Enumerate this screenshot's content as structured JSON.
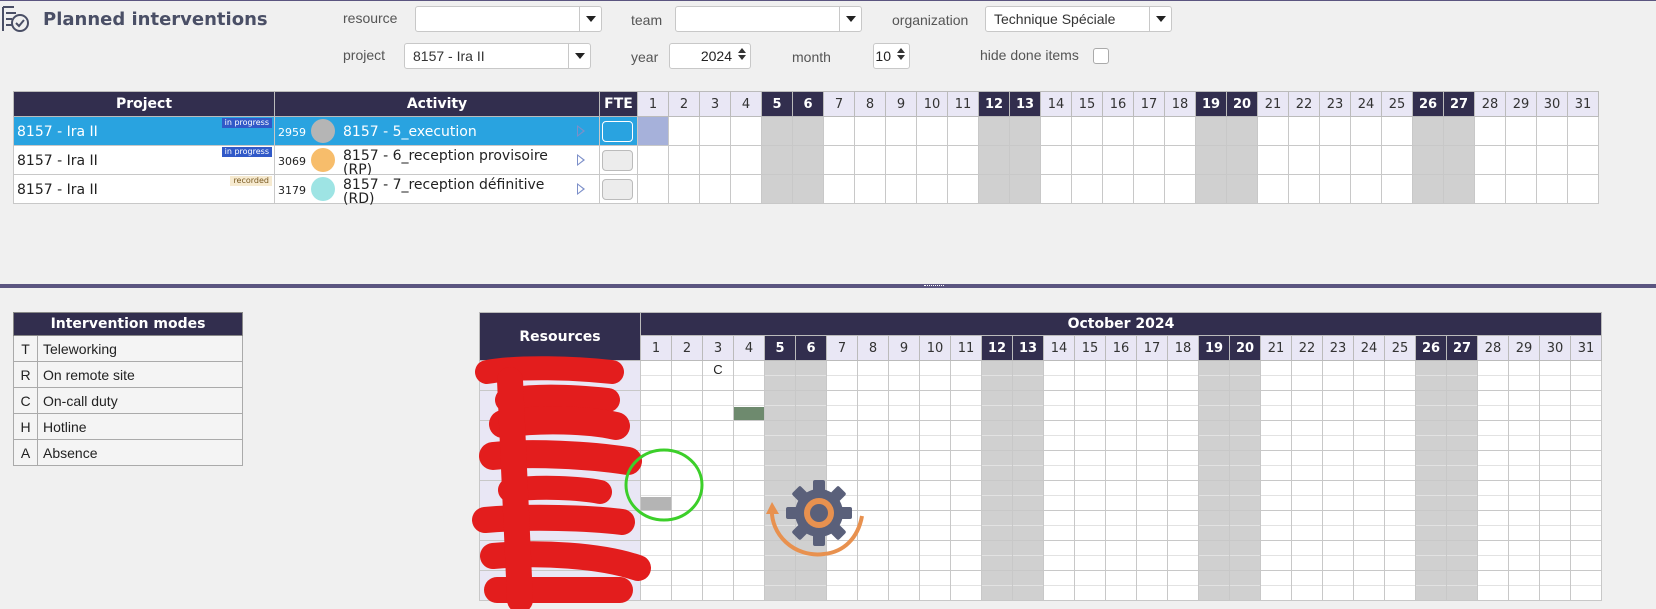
{
  "page": {
    "title": "Planned interventions"
  },
  "filters": {
    "resource_label": "resource",
    "resource_value": "",
    "team_label": "team",
    "team_value": "",
    "organization_label": "organization",
    "organization_value": "Technique Spéciale",
    "project_label": "project",
    "project_value": "8157 - Ira II",
    "year_label": "year",
    "year_value": "2024",
    "month_label": "month",
    "month_value": "10",
    "hide_done_label": "hide done items"
  },
  "planning": {
    "headers": {
      "project": "Project",
      "activity": "Activity",
      "fte": "FTE"
    },
    "days": [
      "1",
      "2",
      "3",
      "4",
      "5",
      "6",
      "7",
      "8",
      "9",
      "10",
      "11",
      "12",
      "13",
      "14",
      "15",
      "16",
      "17",
      "18",
      "19",
      "20",
      "21",
      "22",
      "23",
      "24",
      "25",
      "26",
      "27",
      "28",
      "29",
      "30",
      "31"
    ],
    "weekend_days": [
      5,
      6,
      12,
      13,
      19,
      20,
      26,
      27
    ],
    "rows": [
      {
        "project": "8157 - Ira II",
        "status": "in progress",
        "status_type": "progress",
        "id": "2959",
        "color": "#b5b5b5",
        "activity": "8157 - 5_execution",
        "selected": true
      },
      {
        "project": "8157 - Ira II",
        "status": "in progress",
        "status_type": "progress",
        "id": "3069",
        "color": "#f7bd6b",
        "activity": "8157 - 6_reception provisoire (RP)",
        "selected": false
      },
      {
        "project": "8157 - Ira II",
        "status": "recorded",
        "status_type": "recorded",
        "id": "3179",
        "color": "#9ee4e4",
        "activity": "8157 - 7_reception définitive (RD)",
        "selected": false
      }
    ]
  },
  "modes": {
    "title": "Intervention modes",
    "items": [
      {
        "code": "T",
        "label": "Teleworking"
      },
      {
        "code": "R",
        "label": "On remote site"
      },
      {
        "code": "C",
        "label": "On-call duty"
      },
      {
        "code": "H",
        "label": "Hotline"
      },
      {
        "code": "A",
        "label": "Absence"
      }
    ]
  },
  "resources": {
    "header": "Resources",
    "month_title": "October 2024",
    "row_count": 8,
    "cells": [
      {
        "row": 0,
        "day": 3,
        "mode": "C"
      },
      {
        "row": 1,
        "day": 4,
        "fill": "#6e8a6e"
      },
      {
        "row": 4,
        "day": 1,
        "fill": "#b4b4b4"
      }
    ]
  },
  "colors": {
    "header_bg": "#322e4e",
    "selected_row": "#29a3e0",
    "weekend": "#d0d0d0",
    "redaction": "#e31d1d",
    "annotation_circle": "#3ccf2a",
    "gear": "#5a607a",
    "gear_accent": "#e8914f"
  },
  "icons": {
    "logo": "calendar-check-icon",
    "loading": "gear-refresh-icon"
  }
}
